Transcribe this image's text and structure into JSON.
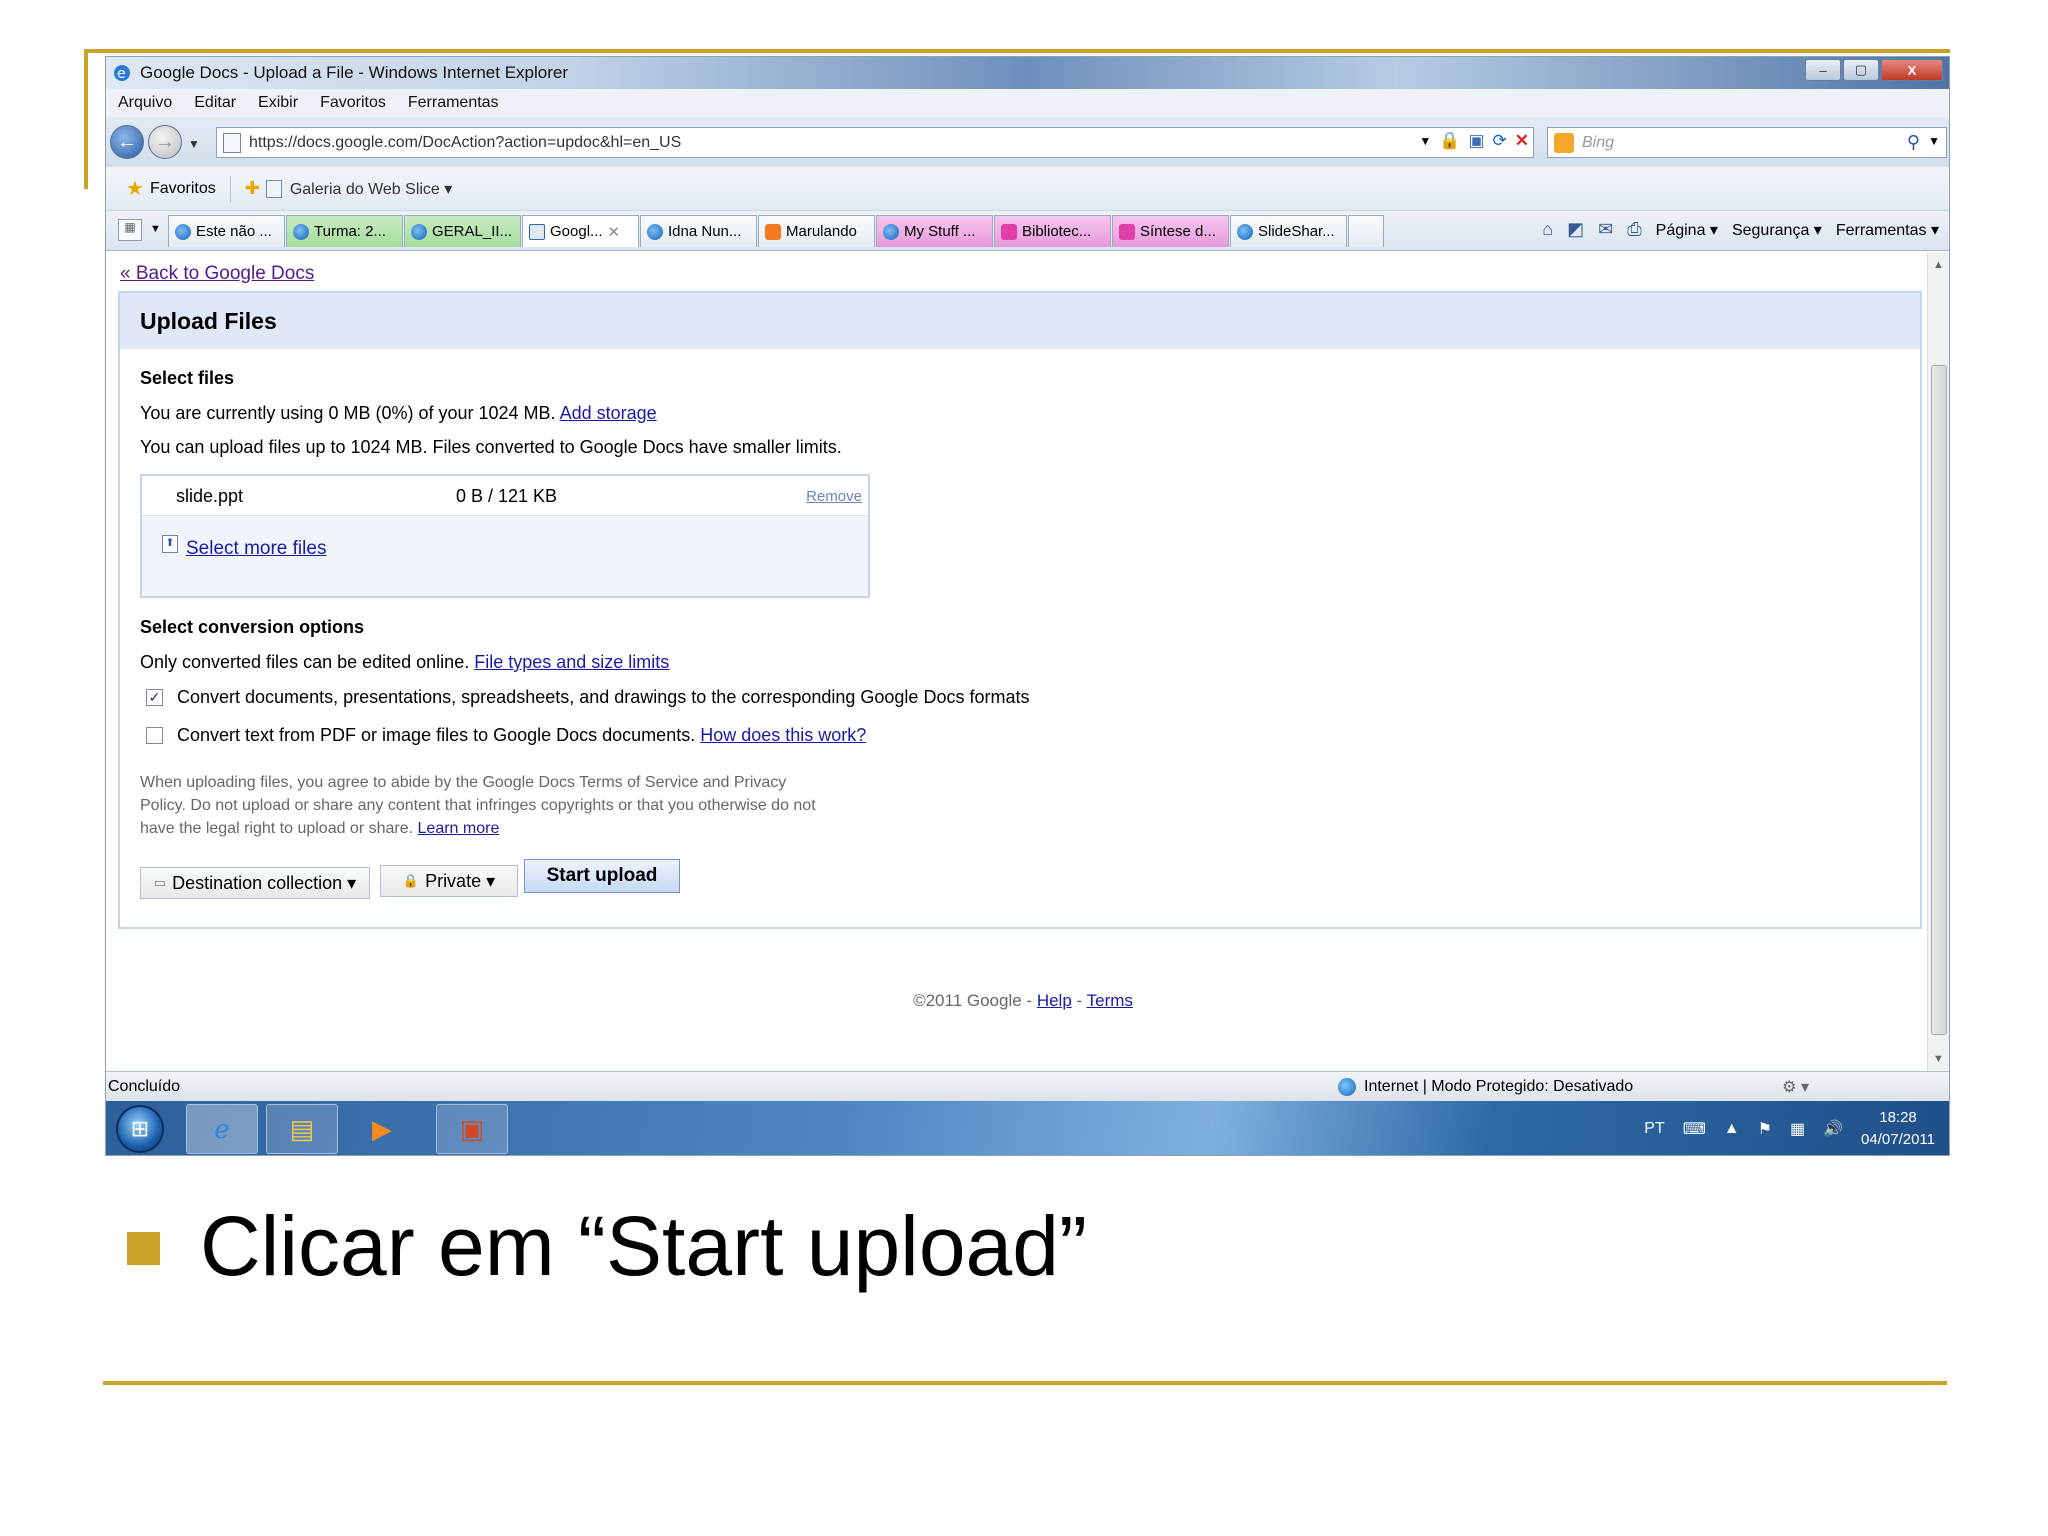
{
  "window": {
    "title": "Google Docs - Upload a File - Windows Internet Explorer",
    "controls": [
      "–",
      "▢",
      "X"
    ]
  },
  "menu": [
    "Arquivo",
    "Editar",
    "Exibir",
    "Favoritos",
    "Ferramentas"
  ],
  "address": {
    "url": "https://docs.google.com/DocAction?action=updoc&hl=en_US",
    "search_placeholder": "Bing"
  },
  "favorites_bar": {
    "favorites_label": "Favoritos",
    "web_slice_label": "Galeria do Web Slice ▾"
  },
  "tabs": [
    {
      "label": "Este não ...",
      "color": "plain",
      "icon": "ie-icon"
    },
    {
      "label": "Turma: 2...",
      "color": "green",
      "icon": "ie-icon"
    },
    {
      "label": "GERAL_II...",
      "color": "green",
      "icon": "ie-icon"
    },
    {
      "label": "Googl...",
      "color": "active",
      "icon": "docs-icon"
    },
    {
      "label": "Idna Nun...",
      "color": "plain",
      "icon": "ie-icon"
    },
    {
      "label": "Marulando",
      "color": "plain",
      "icon": "blogger-icon"
    },
    {
      "label": "My Stuff ...",
      "color": "pink",
      "icon": "ie-icon"
    },
    {
      "label": "Bibliotec...",
      "color": "pink",
      "icon": "pink-icon"
    },
    {
      "label": "Síntese d...",
      "color": "pink",
      "icon": "pink-icon"
    },
    {
      "label": "SlideShar...",
      "color": "plain",
      "icon": "ie-icon"
    }
  ],
  "command_bar": {
    "page": "Página ▾",
    "security": "Segurança ▾",
    "tools": "Ferramentas ▾"
  },
  "page": {
    "back_link": "« Back to Google Docs",
    "panel_title": "Upload Files",
    "select_files_heading": "Select files",
    "usage_text": "You are currently using 0 MB (0%) of your 1024 MB.",
    "add_storage": "Add storage",
    "limit_text": "You can upload files up to 1024 MB. Files converted to Google Docs have smaller limits.",
    "file": {
      "name": "slide.ppt",
      "progress": "0 B / 121 KB",
      "remove": "Remove"
    },
    "select_more": "Select more files",
    "conversion_heading": "Select conversion options",
    "conversion_text": "Only converted files can be edited online.",
    "file_types_link": "File types and size limits",
    "convert_docs": {
      "label": "Convert documents, presentations, spreadsheets, and drawings to the corresponding Google Docs formats",
      "checked": true
    },
    "convert_pdf": {
      "label": "Convert text from PDF or image files to Google Docs documents.",
      "link": "How does this work?",
      "checked": false
    },
    "legal_text": "When uploading files, you agree to abide by the Google Docs Terms of Service and Privacy Policy. Do not upload or share any content that infringes copyrights or that you otherwise do not have the legal right to upload or share.",
    "learn_more": "Learn more",
    "destination_button": "Destination collection ▾",
    "privacy_button": "Private ▾",
    "start_upload_button": "Start upload",
    "footer_copyright": "©2011 Google -",
    "footer_help": "Help",
    "footer_sep": "-",
    "footer_terms": "Terms"
  },
  "status_bar": {
    "status": "Concluído",
    "zone": "Internet | Modo Protegido: Desativado"
  },
  "taskbar": {
    "language": "PT",
    "time": "18:28",
    "date": "04/07/2011"
  },
  "slide": {
    "bullet": "Clicar em “Start upload”",
    "accent_color": "#c9a227"
  }
}
